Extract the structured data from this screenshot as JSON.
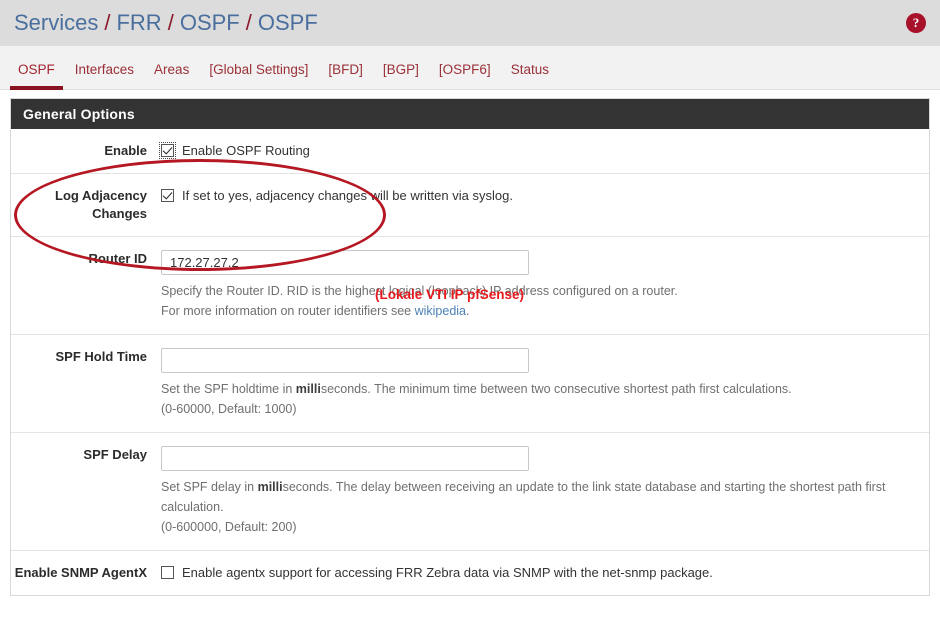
{
  "breadcrumb": {
    "items": [
      "Services",
      "FRR",
      "OSPF",
      "OSPF"
    ],
    "separator": "/",
    "help_icon": "?"
  },
  "tabs": [
    {
      "label": "OSPF",
      "active": true
    },
    {
      "label": "Interfaces",
      "active": false
    },
    {
      "label": "Areas",
      "active": false
    },
    {
      "label": "[Global Settings]",
      "active": false
    },
    {
      "label": "[BFD]",
      "active": false
    },
    {
      "label": "[BGP]",
      "active": false
    },
    {
      "label": "[OSPF6]",
      "active": false
    },
    {
      "label": "Status",
      "active": false
    }
  ],
  "panel": {
    "heading": "General Options",
    "rows": {
      "enable": {
        "label": "Enable",
        "checkbox_label": "Enable OSPF Routing",
        "checked": true
      },
      "log_adjacency": {
        "label": "Log Adjacency Changes",
        "checkbox_label": "If set to yes, adjacency changes will be written via syslog.",
        "checked": true
      },
      "router_id": {
        "label": "Router ID",
        "value": "172.27.27.2",
        "help_line1_a": "Specify the Router ID. RID is the highest logical (loopback) IP address configured on a router.",
        "help_line2_a": "For more information on router identifiers see ",
        "help_link": "wikipedia",
        "help_line2_b": "."
      },
      "spf_hold_time": {
        "label": "SPF Hold Time",
        "value": "",
        "help_a": "Set the SPF holdtime in ",
        "help_bold": "milli",
        "help_b": "seconds. The minimum time between two consecutive shortest path first calculations.",
        "help_range": "(0-60000, Default: 1000)"
      },
      "spf_delay": {
        "label": "SPF Delay",
        "value": "",
        "help_a": "Set SPF delay in ",
        "help_bold": "milli",
        "help_b": "seconds. The delay between receiving an update to the link state database and starting the shortest path first calculation.",
        "help_range": "(0-600000, Default: 200)"
      },
      "snmp_agentx": {
        "label": "Enable SNMP AgentX",
        "checkbox_label": "Enable agentx support for accessing FRR Zebra data via SNMP with the net-snmp package.",
        "checked": false
      }
    }
  },
  "annotations": {
    "router_id_note": "(Lokale VTI IP pfSense)"
  },
  "colors": {
    "accent_red": "#8b1220",
    "annotation_red": "#e8191e",
    "breadcrumb_blue": "#4a6f9e",
    "panel_heading_bg": "#333333",
    "link_blue": "#4a7fb5"
  }
}
